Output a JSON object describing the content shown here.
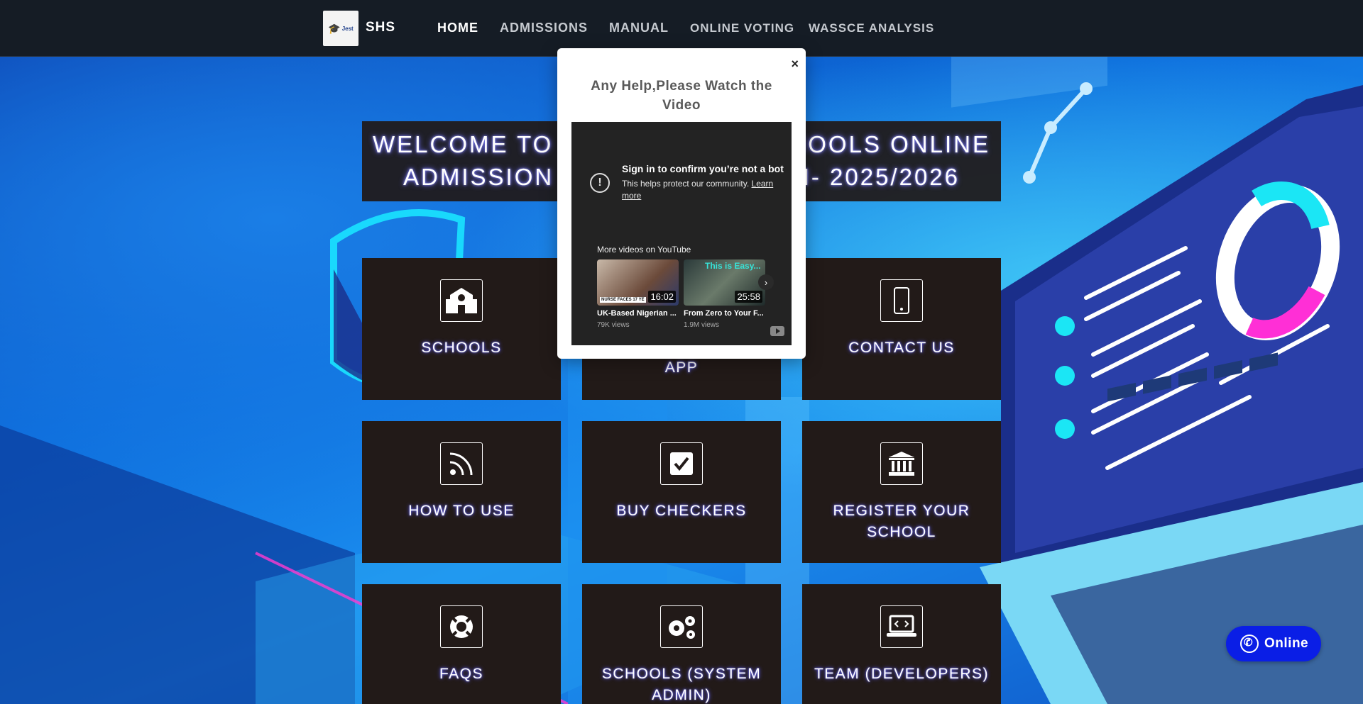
{
  "brand": {
    "logo_text": "Jest",
    "name": "SHS"
  },
  "nav": {
    "home": "HOME",
    "admissions": "ADMISSIONS",
    "manual": "MANUAL",
    "online_voting": "ONLINE VOTING",
    "wassce_analysis": "WASSCE ANALYSIS"
  },
  "welcome": {
    "line1": "WELCOME TO J",
    "line1_end": "HOOLS ONLINE",
    "line2": "ADMISSION W",
    "line2_end": "M- 2025/2026"
  },
  "cards": {
    "schools": "SCHOOLS",
    "app": "APP",
    "contact_us": "CONTACT US",
    "how_to_use": "HOW TO USE",
    "buy_checkers": "BUY CHECKERS",
    "register_your_school": "REGISTER YOUR SCHOOL",
    "faqs": "FAQS",
    "schools_system_admin": "SCHOOLS (SYSTEM ADMIN)",
    "team_developers": "TEAM (DEVELOPERS)"
  },
  "modal": {
    "close": "×",
    "title": "Any Help,Please Watch the Video",
    "video": {
      "signin_title": "Sign in to confirm you’re not a bot",
      "signin_sub": "This helps protect our community.",
      "learn_more": "Learn more",
      "more_videos": "More videos on YouTube",
      "items": [
        {
          "duration": "16:02",
          "title": "UK-Based Nigerian ...",
          "views": "79K views",
          "tag": "NURSE FACES 17 YE"
        },
        {
          "duration": "25:58",
          "title": "From Zero to Your F...",
          "views": "1.9M views",
          "tag": "This is Easy..."
        }
      ]
    }
  },
  "online_button": "Online"
}
